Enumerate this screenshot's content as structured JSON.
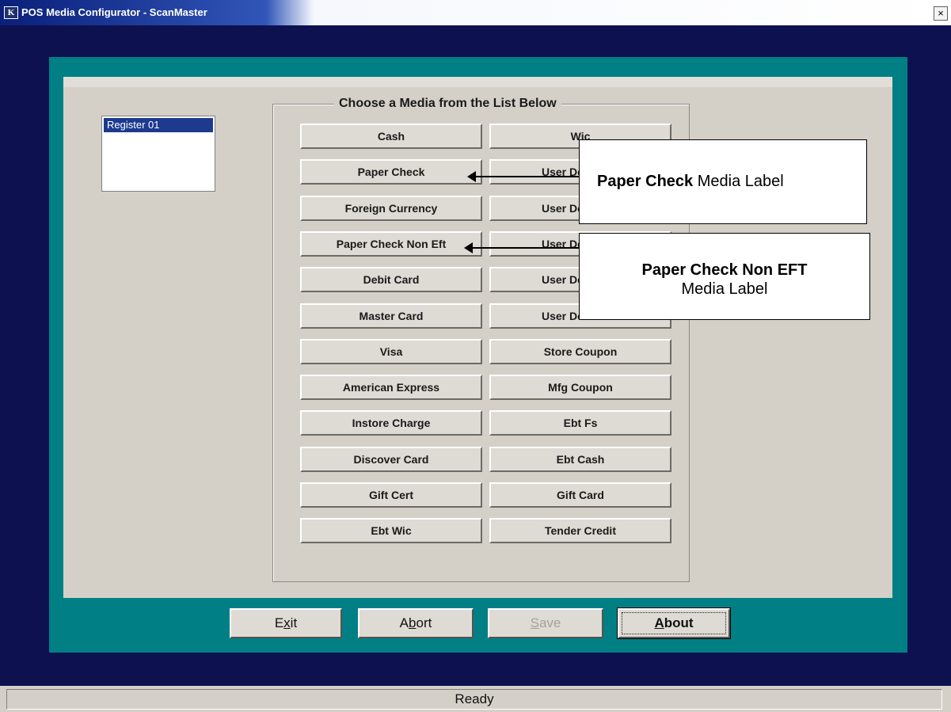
{
  "window": {
    "title": "POS Media Configurator - ScanMaster",
    "close_glyph": "×"
  },
  "icons": {
    "app": "app-icon",
    "close": "close-icon"
  },
  "registers": [
    "Register 01"
  ],
  "media_group": {
    "title": "Choose a Media from the List Below",
    "left_column": [
      "Cash",
      "Paper Check",
      "Foreign Currency",
      "Paper Check Non Eft",
      "Debit Card",
      "Master Card",
      "Visa",
      "American Express",
      "Instore Charge",
      "Discover Card",
      "Gift Cert",
      "Ebt Wic"
    ],
    "right_column": [
      "Wic",
      "User Defined 1",
      "User Defined 2",
      "User Defined 3",
      "User Defined 4",
      "User Defined 5",
      "Store Coupon",
      "Mfg Coupon",
      "Ebt Fs",
      "Ebt Cash",
      "Gift Card",
      "Tender Credit"
    ]
  },
  "callouts": [
    {
      "bold": "Paper Check",
      "text": "Media Label"
    },
    {
      "bold": "Paper Check Non EFT",
      "text": "Media Label"
    }
  ],
  "actions": {
    "exit": {
      "prefix": "E",
      "mnemonic": "x",
      "suffix": "it"
    },
    "abort": {
      "prefix": "A",
      "mnemonic": "b",
      "suffix": "ort"
    },
    "save": {
      "prefix": "",
      "mnemonic": "S",
      "suffix": "ave",
      "enabled": false
    },
    "about": {
      "prefix": "",
      "mnemonic": "A",
      "suffix": "bout"
    }
  },
  "status": {
    "text": "Ready"
  },
  "colors": {
    "frame": "#0d1150",
    "teal": "#007f85",
    "panel": "#d4d0c8",
    "selection": "#1d3a8f"
  }
}
